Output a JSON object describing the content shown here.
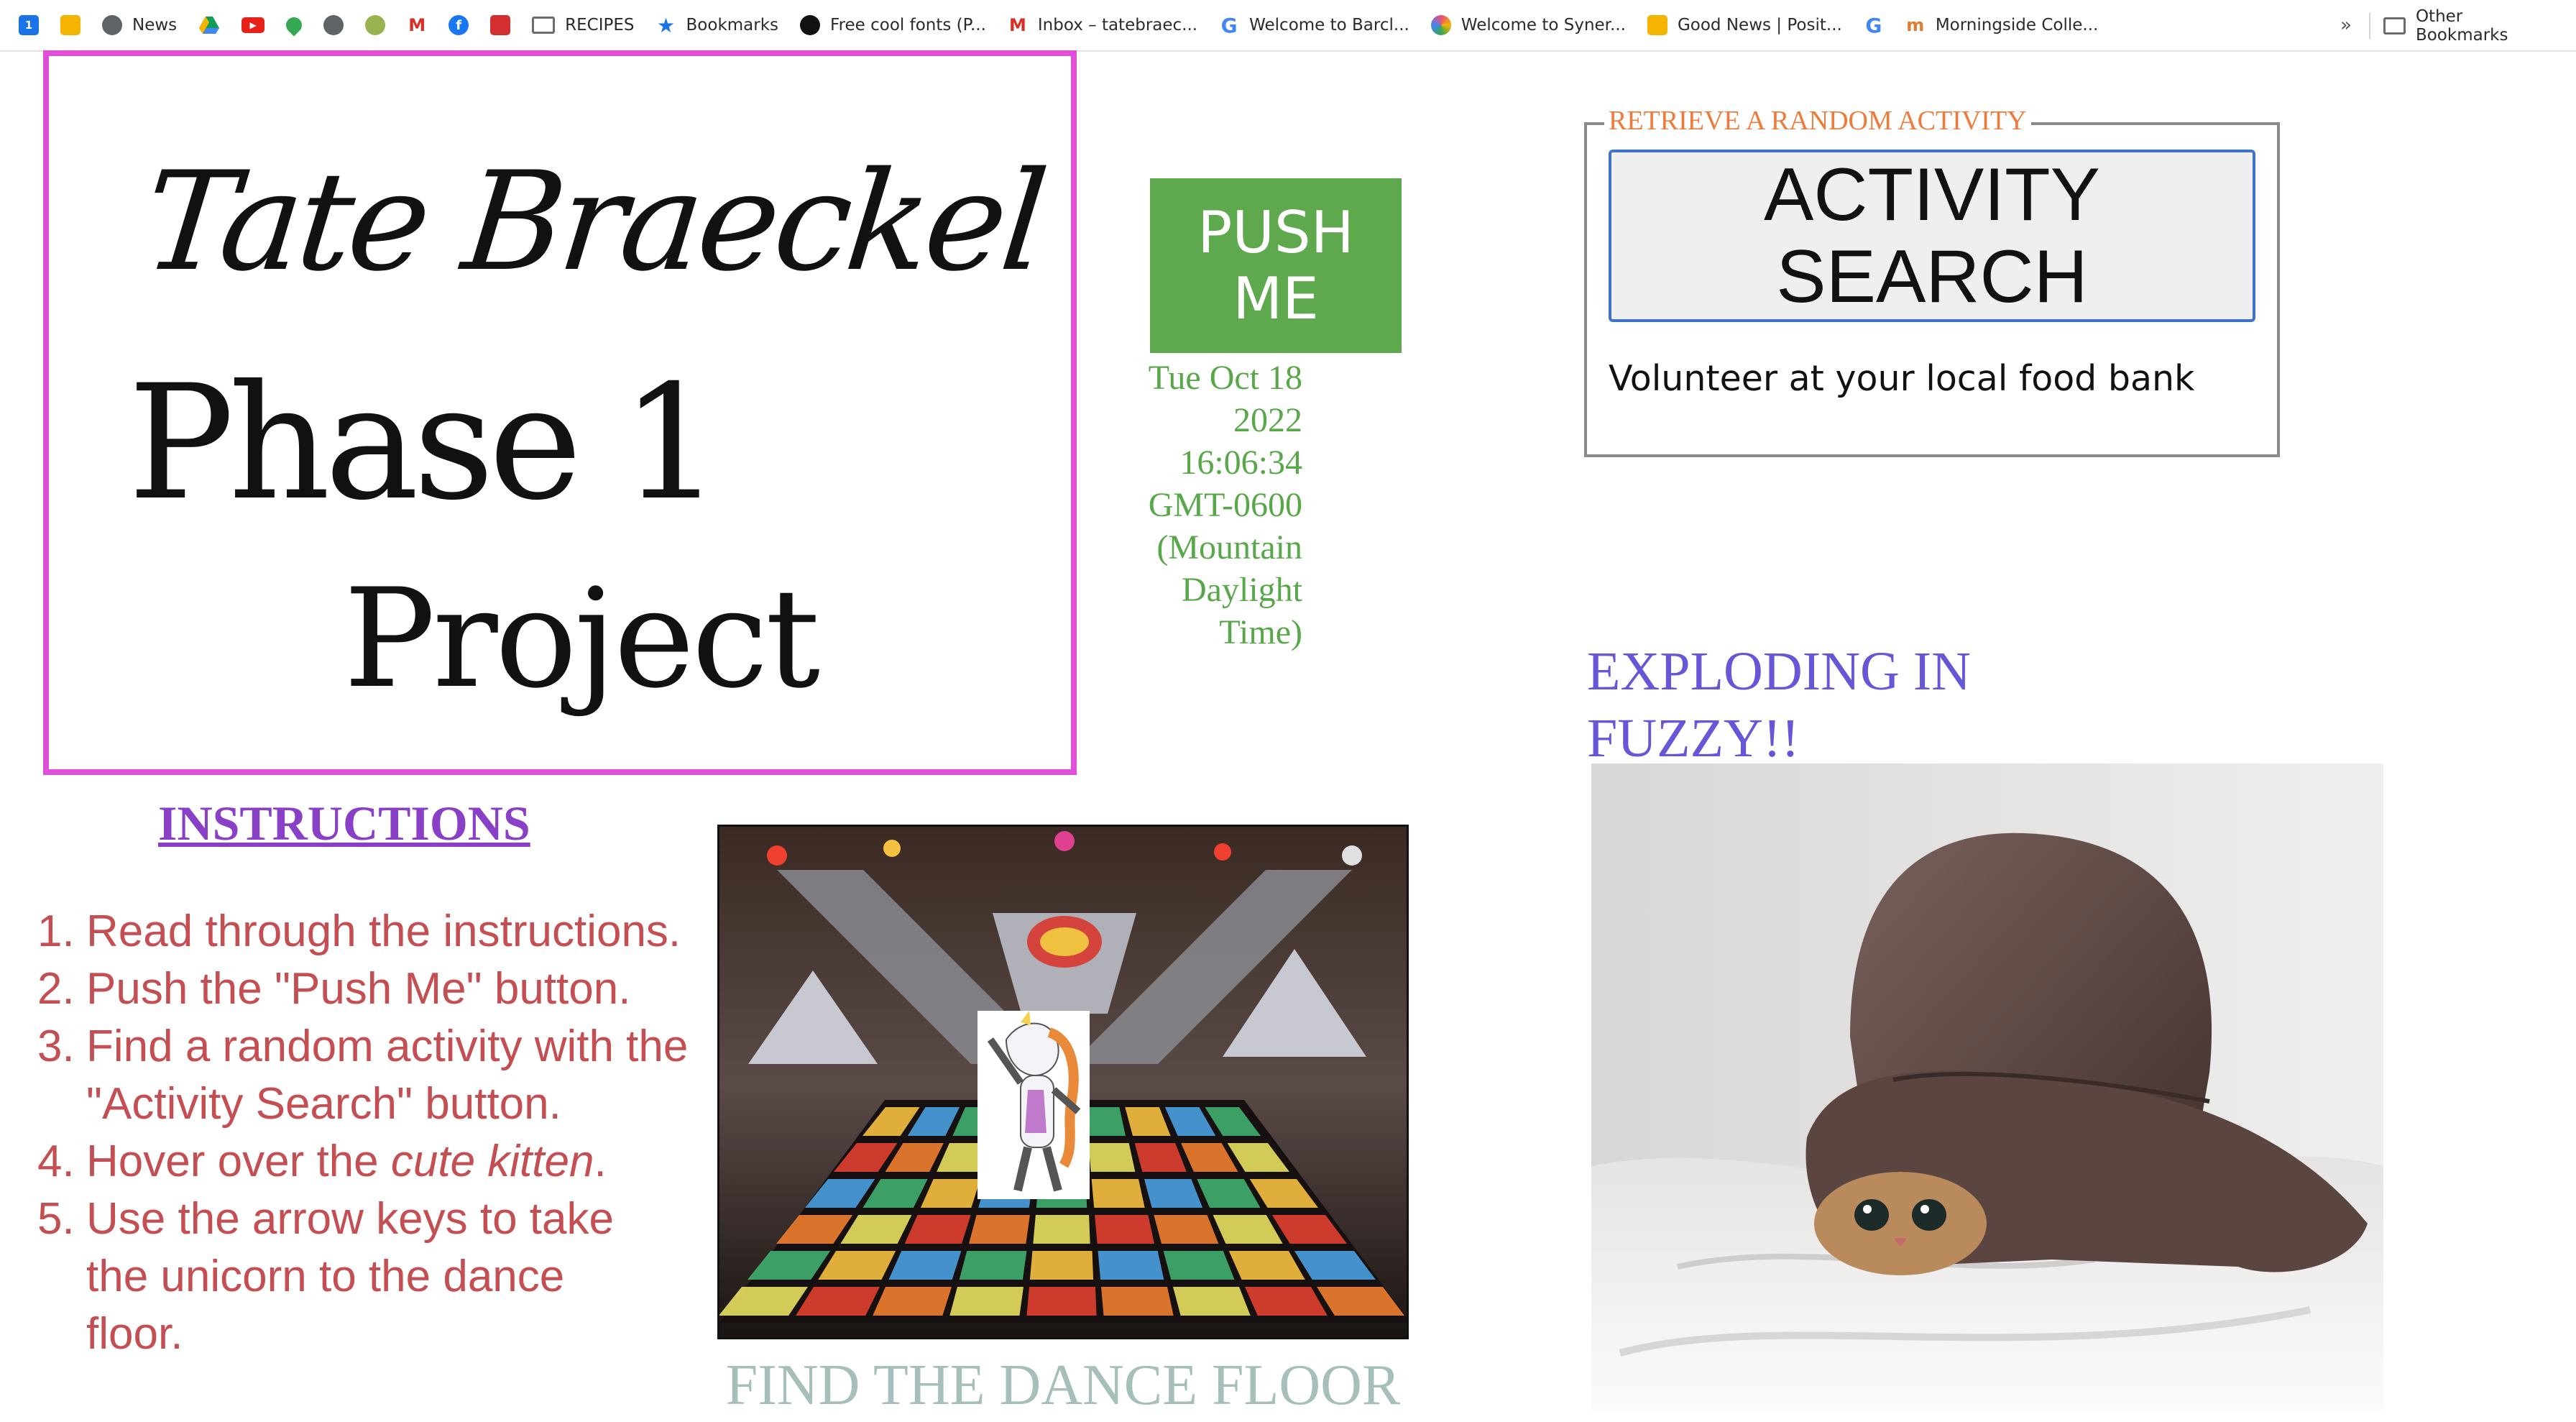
{
  "bookmarks_bar": {
    "items": [
      {
        "label": "",
        "icon": "calendar-icon",
        "color": "#1a73e8"
      },
      {
        "label": "",
        "icon": "photos-icon",
        "color": "#f4b400"
      },
      {
        "label": "News",
        "icon": "globe-icon",
        "color": "#5f6368"
      },
      {
        "label": "",
        "icon": "drive-icon",
        "color": "#0f9d58"
      },
      {
        "label": "",
        "icon": "youtube-icon",
        "color": "#e62117"
      },
      {
        "label": "",
        "icon": "maps-icon",
        "color": "#34a853"
      },
      {
        "label": "",
        "icon": "globe-icon",
        "color": "#5f6368"
      },
      {
        "label": "",
        "icon": "circle-icon",
        "color": "#9ab350"
      },
      {
        "label": "",
        "icon": "gmail-icon",
        "color": "#d93025"
      },
      {
        "label": "",
        "icon": "facebook-icon",
        "color": "#1877f2"
      },
      {
        "label": "",
        "icon": "bookmark-red-icon",
        "color": "#d32f2f"
      },
      {
        "label": "RECIPES",
        "icon": "folder-icon",
        "color": "#6b6b6b"
      },
      {
        "label": "Bookmarks",
        "icon": "star-icon",
        "color": "#1a73e8"
      },
      {
        "label": "Free cool fonts (P...",
        "icon": "font-site-icon",
        "color": "#111111"
      },
      {
        "label": "Inbox – tatebraec...",
        "icon": "gmail-icon",
        "color": "#d93025"
      },
      {
        "label": "Welcome to Barcl...",
        "icon": "google-icon",
        "color": "#4285f4"
      },
      {
        "label": "Welcome to Syner...",
        "icon": "synergy-icon",
        "color": "#e94e77"
      },
      {
        "label": "Good News | Posit...",
        "icon": "sunglasses-icon",
        "color": "#f4b400"
      },
      {
        "label": "",
        "icon": "google-icon",
        "color": "#4285f4"
      },
      {
        "label": "Morningside Colle...",
        "icon": "college-icon",
        "color": "#e07b2f"
      }
    ],
    "overflow": "»",
    "other_label": "Other Bookmarks"
  },
  "title": {
    "line1": "Tate Braeckel",
    "line2": "Phase 1",
    "line3": "Project"
  },
  "push": {
    "label": "PUSH ME",
    "timestamp": "Tue Oct 18 2022 16:06:34 GMT-0600 (Mountain Daylight Time)",
    "color": "#5ea84e"
  },
  "activity": {
    "legend": "RETRIEVE A RANDOM ACTIVITY",
    "button_label": "ACTIVITY SEARCH",
    "result": "Volunteer at your local food bank"
  },
  "instructions": {
    "title": "INSTRUCTIONS",
    "steps": [
      {
        "num": "1.",
        "text": "Read through the instructions."
      },
      {
        "num": "2.",
        "text": "Push the \"Push Me\" button."
      },
      {
        "num": "3.",
        "text": "Find a random activity with the \"Activity Search\" button."
      },
      {
        "num": "4.",
        "pre": "Hover over the ",
        "em": "cute kitten",
        "post": "."
      },
      {
        "num": "5.",
        "text": "Use the arrow keys to take the unicorn to the dance floor."
      }
    ]
  },
  "dance": {
    "caption": "FIND THE DANCE FLOOR"
  },
  "kitten": {
    "heading": "EXPLODING IN FUZZY!!"
  }
}
